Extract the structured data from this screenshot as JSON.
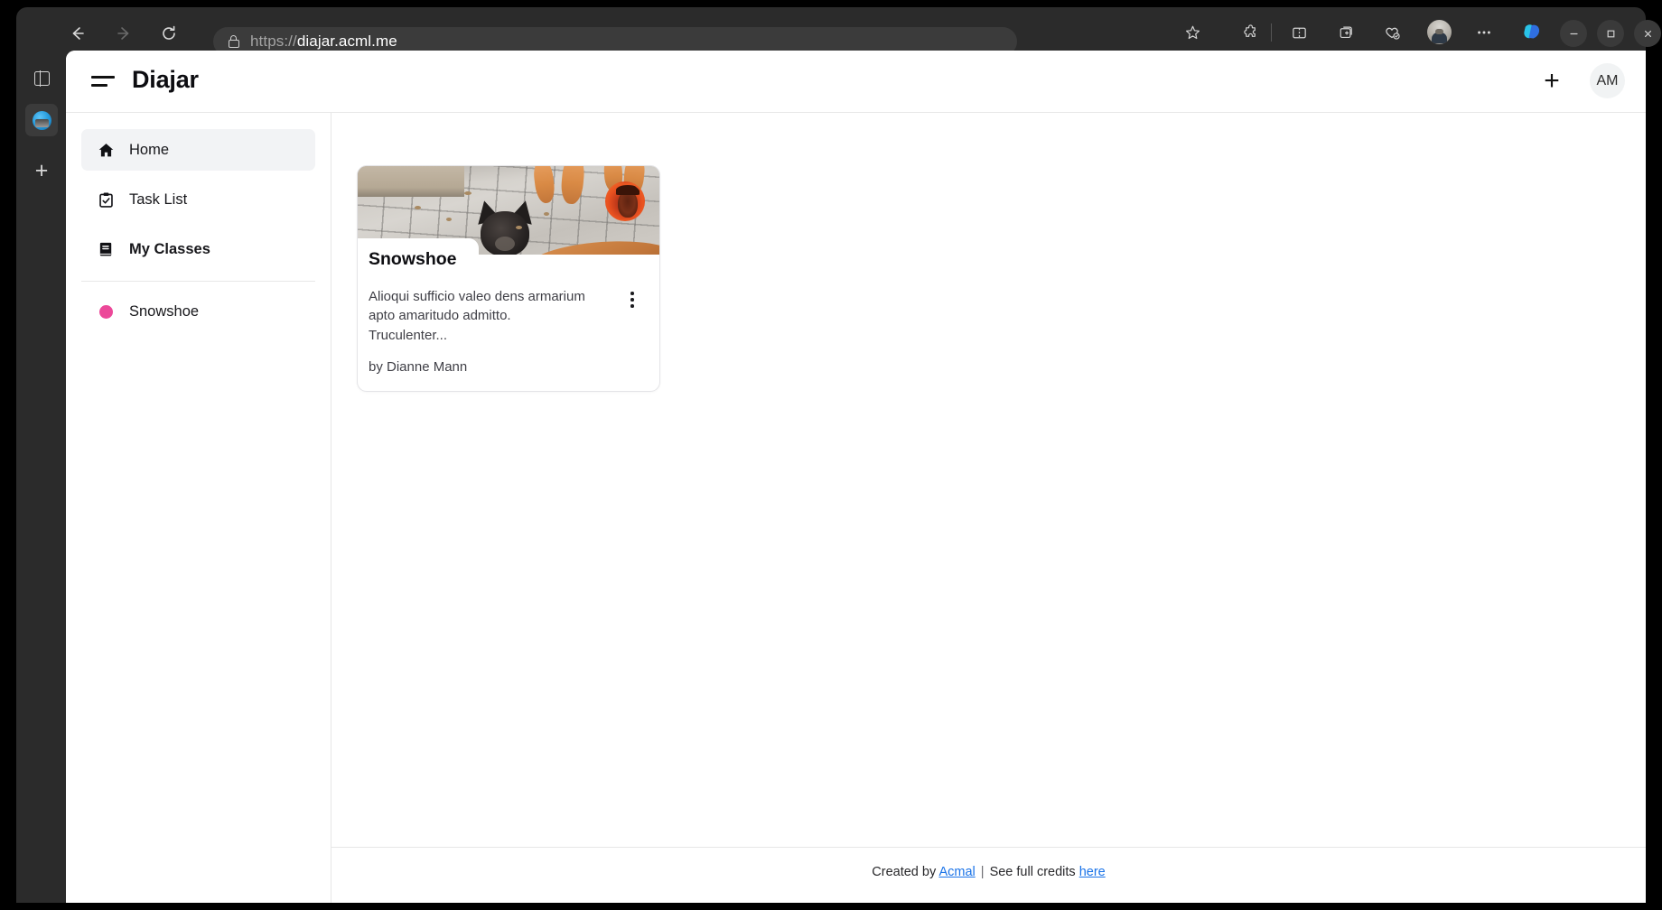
{
  "browser": {
    "url_scheme": "https://",
    "url_host": "diajar.acml.me",
    "url_full": "https://diajar.acml.me",
    "back_label": "Back",
    "forward_label": "Forward",
    "refresh_label": "Refresh",
    "lock_icon": "lock-icon",
    "left_rail": [
      {
        "name": "tab-panel-icon",
        "label": "Tab actions"
      },
      {
        "name": "app-site-icon",
        "label": "Diajar"
      },
      {
        "name": "add-sidebar-icon",
        "label": "Add"
      }
    ],
    "toolbar_icons": [
      {
        "name": "favorites-star-icon",
        "label": "Add this page to favorites"
      },
      {
        "name": "extensions-puzzle-icon",
        "label": "Extensions"
      },
      {
        "name": "split-screen-icon",
        "label": "Split screen"
      },
      {
        "name": "collections-icon",
        "label": "Collections"
      },
      {
        "name": "browser-essentials-icon",
        "label": "Browser essentials"
      },
      {
        "name": "profile-avatar-icon",
        "label": "Profile"
      },
      {
        "name": "settings-more-icon",
        "label": "Settings and more"
      },
      {
        "name": "copilot-icon",
        "label": "Copilot"
      }
    ],
    "window_controls": [
      {
        "name": "minimize-button",
        "glyph": "–"
      },
      {
        "name": "maximize-button",
        "glyph": "□"
      },
      {
        "name": "close-button",
        "glyph": "✕"
      }
    ]
  },
  "header": {
    "menu_icon": "hamburger-menu-icon",
    "title": "Diajar",
    "add_label": "+",
    "avatar_initials": "AM"
  },
  "sidebar": {
    "items": [
      {
        "label": "Home",
        "icon": "home-icon",
        "active": true,
        "bold": false
      },
      {
        "label": "Task List",
        "icon": "clipboard-check-icon",
        "active": false,
        "bold": false
      },
      {
        "label": "My Classes",
        "icon": "book-icon",
        "active": false,
        "bold": true
      }
    ],
    "classes": [
      {
        "label": "Snowshoe",
        "color": "#ec4899"
      }
    ]
  },
  "main": {
    "cards": [
      {
        "title": "Snowshoe",
        "description": "Alioqui sufficio valeo dens armarium apto amaritudo admitto. Truculenter...",
        "author": "by Dianne Mann",
        "menu_icon": "kebab-menu-icon",
        "banner_alt": "cat-and-dog-on-pavement-photo",
        "avatar_alt": "class-owner-avatar"
      }
    ]
  },
  "footer": {
    "created_by_prefix": "Created by ",
    "creator_link": "Acmal",
    "separator": " | ",
    "credits_prefix": "See full credits ",
    "credits_link": "here"
  },
  "colors": {
    "accent_pink": "#ec4899",
    "link_blue": "#1a73e8",
    "sidebar_active_bg": "#f2f3f5",
    "border": "#e7e7e7"
  }
}
